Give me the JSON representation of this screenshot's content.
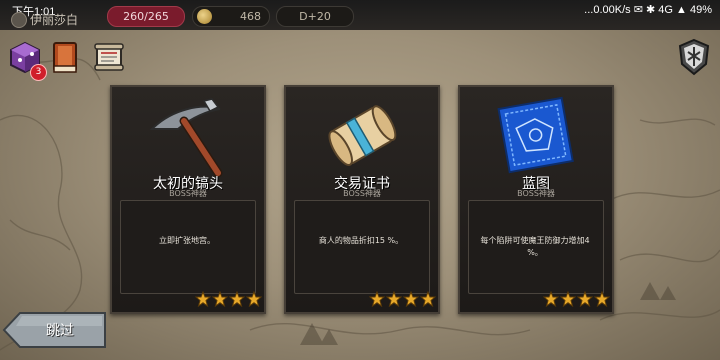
{
  "status_bar": {
    "time": "下午1:01",
    "network": "...0.00K/s",
    "network_type": "4G",
    "battery": "49%"
  },
  "player": {
    "name": "伊丽莎白",
    "hp": "260/265",
    "gold": "468",
    "day": "D+20"
  },
  "menu": {
    "cube_badge": "3"
  },
  "cards": [
    {
      "title": "太初的镐头",
      "subtitle": "BOSS神器",
      "description": "立即扩张地宫。",
      "stars": 4,
      "icon": "pickaxe-icon"
    },
    {
      "title": "交易证书",
      "subtitle": "BOSS神器",
      "description": "商人的物品折扣15 %。",
      "stars": 4,
      "icon": "scroll-icon"
    },
    {
      "title": "蓝图",
      "subtitle": "BOSS神器",
      "description": "每个陷阱可使魔王防御力增加4 %。",
      "stars": 4,
      "icon": "blueprint-icon"
    }
  ],
  "skip_button": {
    "label": "跳过"
  },
  "colors": {
    "hp_pill": "#7a1b2c",
    "card_bg": "#1d1a18",
    "star": "#e8a92a",
    "skip_button": "#9aa2a8"
  }
}
